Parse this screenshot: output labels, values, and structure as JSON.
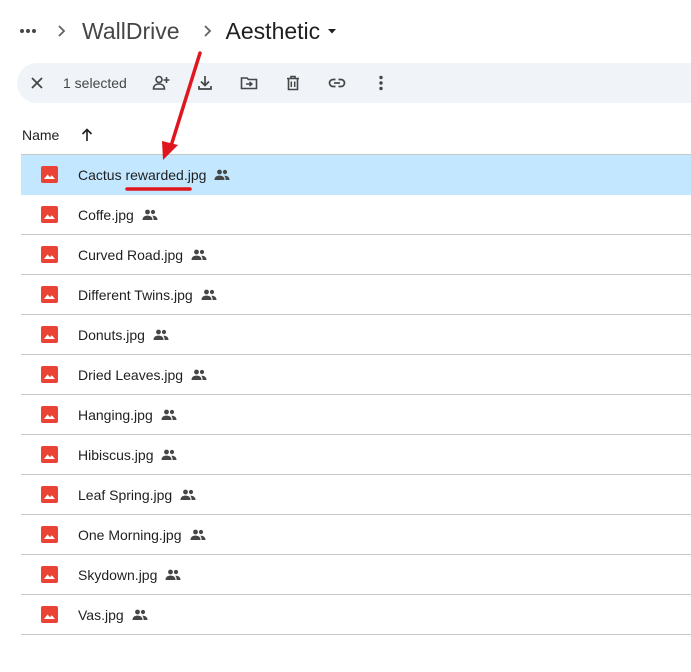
{
  "breadcrumb": {
    "more_icon": "more-horizontal-icon",
    "items": [
      "WallDrive",
      "Aesthetic"
    ]
  },
  "toolbar": {
    "close_icon": "close-icon",
    "selected_text": "1 selected",
    "actions": [
      "share-icon",
      "download-icon",
      "move-icon",
      "trash-icon",
      "link-icon",
      "more-vertical-icon"
    ]
  },
  "list": {
    "name_header": "Name",
    "sort_icon": "arrow-up-icon",
    "files": [
      {
        "name": "Cactus rewarded.jpg",
        "selected": true
      },
      {
        "name": "Coffe.jpg"
      },
      {
        "name": "Curved Road.jpg"
      },
      {
        "name": "Different Twins.jpg"
      },
      {
        "name": "Donuts.jpg"
      },
      {
        "name": "Dried Leaves.jpg"
      },
      {
        "name": "Hanging.jpg"
      },
      {
        "name": "Hibiscus.jpg"
      },
      {
        "name": "Leaf Spring.jpg"
      },
      {
        "name": "One Morning.jpg"
      },
      {
        "name": "Skydown.jpg"
      },
      {
        "name": "Vas.jpg"
      }
    ],
    "file_icon": "image-file-icon",
    "shared_icon": "shared-people-icon"
  },
  "colors": {
    "selected_row": "#c2e7ff",
    "toolbar_bg": "#f0f4f9",
    "file_icon_red": "#ea4335",
    "annotation_red": "#e0161f",
    "divider": "#c4c7c5"
  },
  "annotation": {
    "arrow_icon": "red-arrow-annotation",
    "underline": "red-underline-annotation"
  }
}
